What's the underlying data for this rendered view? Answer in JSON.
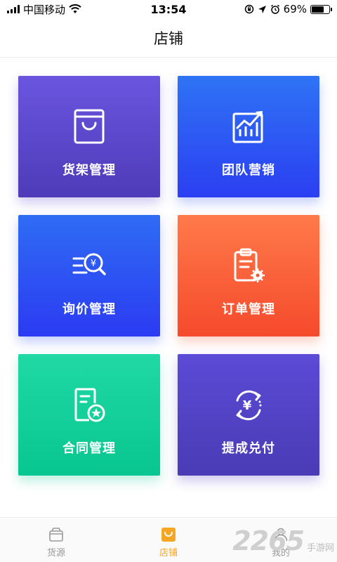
{
  "status_bar": {
    "carrier": "中国移动",
    "time": "13:54",
    "battery_percent": "69%",
    "battery_level": 0.69,
    "icons": [
      "signal-icon",
      "wifi-icon",
      "rotation-lock-icon",
      "location-icon",
      "alarm-icon",
      "battery-icon"
    ]
  },
  "nav": {
    "title": "店铺"
  },
  "tiles": [
    {
      "label": "货架管理",
      "icon": "shopping-bag-icon",
      "color": "#6a55df"
    },
    {
      "label": "团队营销",
      "icon": "chart-growth-icon",
      "color": "#2f73f4"
    },
    {
      "label": "询价管理",
      "icon": "price-search-icon",
      "color": "#2f6cf4"
    },
    {
      "label": "订单管理",
      "icon": "clipboard-gear-icon",
      "color": "#ff7a4a"
    },
    {
      "label": "合同管理",
      "icon": "contract-star-icon",
      "color": "#20d9a5"
    },
    {
      "label": "提成兑付",
      "icon": "cash-exchange-icon",
      "color": "#5b4bd6"
    }
  ],
  "tabs": [
    {
      "label": "货源",
      "icon": "box-icon",
      "active": false
    },
    {
      "label": "店铺",
      "icon": "store-bag-icon",
      "active": true,
      "color": "#f5a623"
    },
    {
      "label": "我的",
      "icon": "user-icon",
      "active": false
    }
  ],
  "watermark": {
    "number": "2265",
    "text": "手游网"
  }
}
